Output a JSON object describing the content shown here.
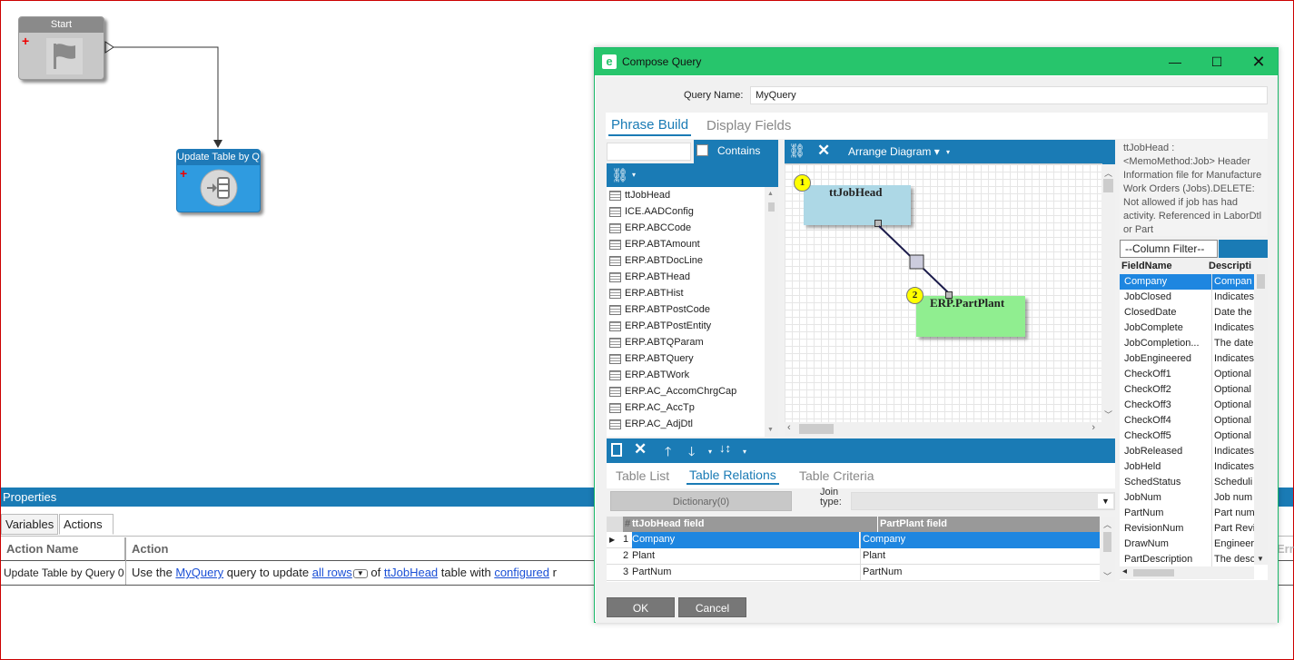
{
  "workflow": {
    "start_label": "Start",
    "update_label": "Update Table by Q"
  },
  "properties": {
    "title": "Properties",
    "tabs": [
      "Variables",
      "Actions"
    ],
    "columns": [
      "Action Name",
      "Action",
      "Err"
    ],
    "row": {
      "name": "Update Table by Query 0",
      "t1": "Use the ",
      "query": "MyQuery",
      "t2": " query to update ",
      "rows": "all rows",
      "t3": " of ",
      "table": "ttJobHead",
      "t4": " table with ",
      "configured": "configured",
      "t5": " r"
    }
  },
  "dialog": {
    "title": "Compose Query",
    "query_name_label": "Query Name:",
    "query_name_value": "MyQuery",
    "tabs": [
      "Phrase Build",
      "Display Fields"
    ],
    "contains_label": "Contains",
    "arrange_label": "Arrange Diagram",
    "tables": [
      "ttJobHead",
      "ICE.AADConfig",
      "ERP.ABCCode",
      "ERP.ABTAmount",
      "ERP.ABTDocLine",
      "ERP.ABTHead",
      "ERP.ABTHist",
      "ERP.ABTPostCode",
      "ERP.ABTPostEntity",
      "ERP.ABTQParam",
      "ERP.ABTQuery",
      "ERP.ABTWork",
      "ERP.AC_AccomChrgCap",
      "ERP.AC_AccTp",
      "ERP.AC_AdjDtl"
    ],
    "diagram": {
      "box1_num": "1",
      "box1_name": "ttJobHead",
      "box2_num": "2",
      "box2_name": "ERP.PartPlant"
    },
    "description": "ttJobHead : <MemoMethod:Job> Header Information file for Manufacture Work Orders (Jobs).DELETE: Not allowed if job has had activity. Referenced in LaborDtl or Part",
    "column_filter": "--Column Filter--",
    "field_headers": [
      "FieldName",
      "Descripti"
    ],
    "fields": [
      [
        "Company",
        "Compan"
      ],
      [
        "JobClosed",
        "Indicates"
      ],
      [
        "ClosedDate",
        "Date the"
      ],
      [
        "JobComplete",
        "Indicates"
      ],
      [
        "JobCompletion...",
        "The date"
      ],
      [
        "JobEngineered",
        "Indicates"
      ],
      [
        "CheckOff1",
        "Optional"
      ],
      [
        "CheckOff2",
        "Optional"
      ],
      [
        "CheckOff3",
        "Optional"
      ],
      [
        "CheckOff4",
        "Optional"
      ],
      [
        "CheckOff5",
        "Optional"
      ],
      [
        "JobReleased",
        "Indicates"
      ],
      [
        "JobHeld",
        "Indicates"
      ],
      [
        "SchedStatus",
        "Scheduli"
      ],
      [
        "JobNum",
        "Job num"
      ],
      [
        "PartNum",
        "Part num"
      ],
      [
        "RevisionNum",
        "Part Revi"
      ],
      [
        "DrawNum",
        "Engineer"
      ],
      [
        "PartDescription",
        "The desc"
      ]
    ],
    "bottom_tabs": [
      "Table List",
      "Table Relations",
      "Table Criteria"
    ],
    "dictionary_btn": "Dictionary(0)",
    "join_label": "Join type:",
    "rel_headers": [
      "#",
      "ttJobHead field",
      "PartPlant field"
    ],
    "relations": [
      [
        "1",
        "Company",
        "Company"
      ],
      [
        "2",
        "Plant",
        "Plant"
      ],
      [
        "3",
        "PartNum",
        "PartNum"
      ]
    ],
    "ok": "OK",
    "cancel": "Cancel"
  }
}
